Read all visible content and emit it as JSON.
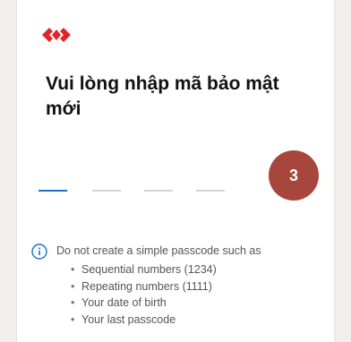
{
  "brand": {
    "logo_icon": "bank-diamond-logo-icon",
    "colors": {
      "logo": "#e0242a",
      "accent": "#1a73c9",
      "badge": "#a6463d"
    }
  },
  "header": {
    "title": "Vui lòng nhập mã bảo mật mới"
  },
  "passcode": {
    "length": 4,
    "filled": 0,
    "active_index": 0
  },
  "step_badge": {
    "label": "3"
  },
  "hint": {
    "icon": "info-icon",
    "lead": "Do not create a simple passcode such as",
    "items": [
      "Sequential numbers (1234)",
      "Repeating numbers (1111)",
      "Your date of birth",
      "Your last passcode"
    ]
  }
}
